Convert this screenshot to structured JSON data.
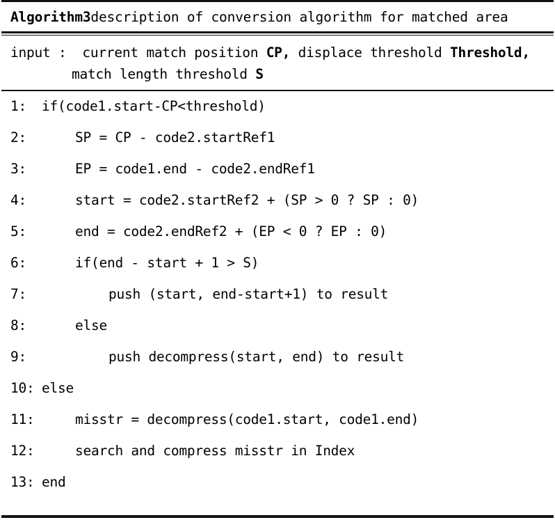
{
  "header": {
    "keyword": "Algorithm3",
    "description": " description of conversion algorithm for matched area"
  },
  "input_section": {
    "label": "input :",
    "line1_pre": "input :  current match position ",
    "line1_bold1": "CP,",
    "line1_mid": " displace threshold ",
    "line1_bold2": "Threshold,",
    "line2_pre": "match length threshold ",
    "line2_bold": "S"
  },
  "lines": [
    {
      "num": "1:",
      "indent": 1,
      "text": "if(code1.start-CP<threshold)"
    },
    {
      "num": "2:",
      "indent": 2,
      "text": "SP = CP - code2.startRef1"
    },
    {
      "num": "3:",
      "indent": 2,
      "text": "EP = code1.end - code2.endRef1"
    },
    {
      "num": "4:",
      "indent": 2,
      "text": "start = code2.startRef2 + (SP > 0 ? SP : 0)"
    },
    {
      "num": "5:",
      "indent": 2,
      "text": "end = code2.endRef2 + (EP < 0 ? EP : 0)"
    },
    {
      "num": "6:",
      "indent": 2,
      "text": "if(end - start + 1 > S)"
    },
    {
      "num": "7:",
      "indent": 3,
      "text": "push (start, end-start+1) to result"
    },
    {
      "num": "8:",
      "indent": 2,
      "text": "else"
    },
    {
      "num": "9:",
      "indent": 3,
      "text": "push decompress(start, end) to result"
    },
    {
      "num": "10:",
      "indent": 0,
      "text": "else"
    },
    {
      "num": "11:",
      "indent": 2,
      "text": "misstr = decompress(code1.start, code1.end)"
    },
    {
      "num": "12:",
      "indent": 2,
      "text": "search and compress misstr in Index"
    },
    {
      "num": "13:",
      "indent": 0,
      "text": "end"
    }
  ],
  "colors": {
    "rule": "#111111",
    "text": "#000000",
    "background": "#ffffff"
  }
}
